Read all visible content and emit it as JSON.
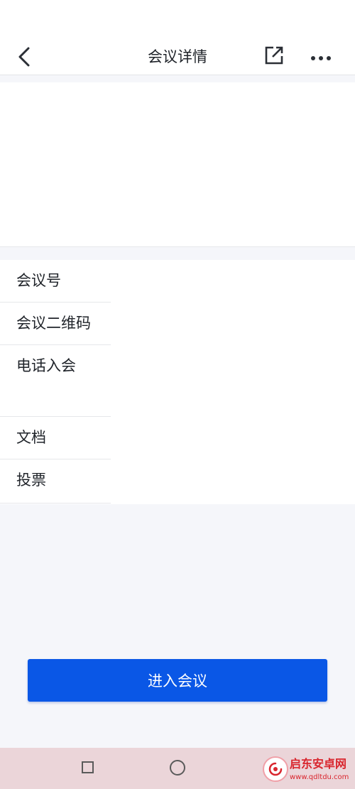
{
  "header": {
    "title": "会议详情",
    "back_icon": "chevron-left-icon",
    "share_icon": "share-external-icon",
    "more_icon": "more-horizontal-icon"
  },
  "menu": {
    "items": [
      {
        "label": "会议号"
      },
      {
        "label": "会议二维码"
      },
      {
        "label": "电话入会"
      },
      {
        "label": "文档"
      },
      {
        "label": "投票"
      }
    ]
  },
  "actions": {
    "enter_label": "进入会议"
  },
  "system_nav": {
    "recent_icon": "square-icon",
    "home_icon": "circle-icon"
  },
  "watermark": {
    "name": "启东安卓网",
    "url": "www.qdltdu.com"
  },
  "colors": {
    "primary": "#0a57e6",
    "background": "#f5f6fa",
    "navbar": "#ebd5d9",
    "watermark": "#d9262e"
  }
}
